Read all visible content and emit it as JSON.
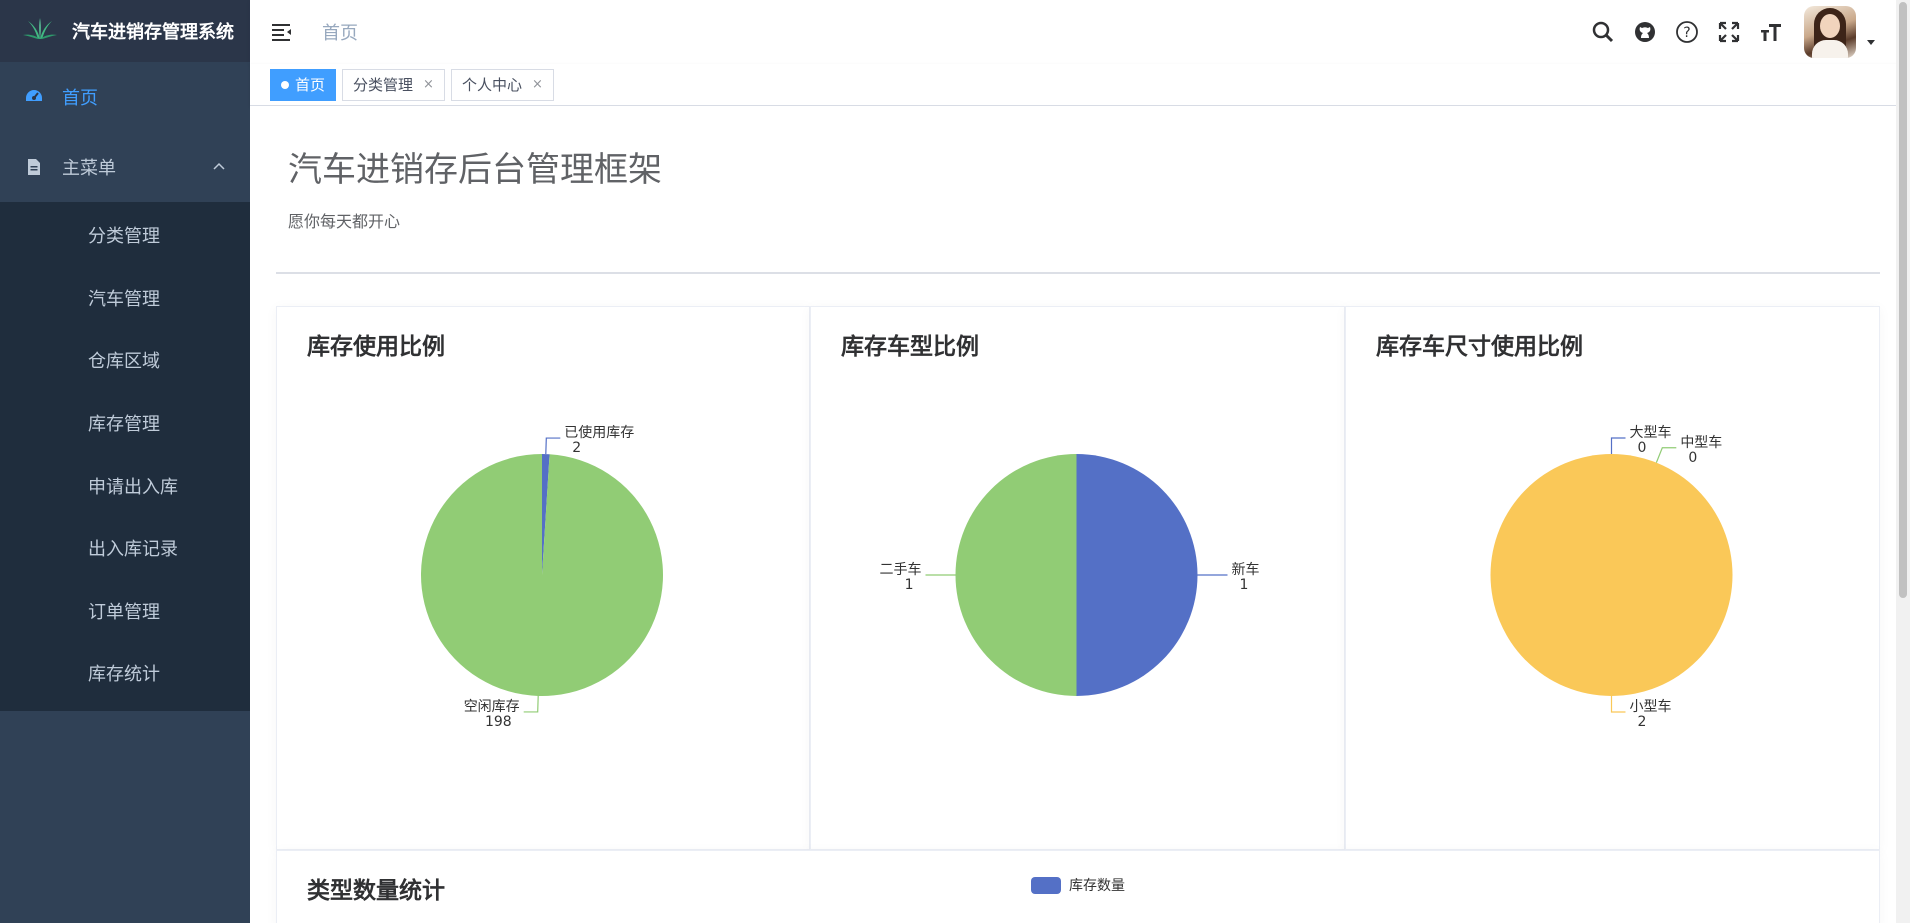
{
  "app": {
    "title": "汽车进销存管理系统"
  },
  "sidebar": {
    "home": "首页",
    "main_menu": "主菜单",
    "sub_items": [
      {
        "label": "分类管理",
        "name": "sidebar-item-category"
      },
      {
        "label": "汽车管理",
        "name": "sidebar-item-car"
      },
      {
        "label": "仓库区域",
        "name": "sidebar-item-warehouse"
      },
      {
        "label": "库存管理",
        "name": "sidebar-item-inventory"
      },
      {
        "label": "申请出入库",
        "name": "sidebar-item-apply-inout"
      },
      {
        "label": "出入库记录",
        "name": "sidebar-item-inout-records"
      },
      {
        "label": "订单管理",
        "name": "sidebar-item-orders"
      },
      {
        "label": "库存统计",
        "name": "sidebar-item-inventory-stats"
      }
    ]
  },
  "navbar": {
    "breadcrumb": "首页",
    "icons": [
      "search-icon",
      "github-icon",
      "help-icon",
      "fullscreen-icon",
      "font-size-icon"
    ]
  },
  "tags": [
    {
      "label": "首页",
      "active": true
    },
    {
      "label": "分类管理",
      "active": false,
      "close": "×"
    },
    {
      "label": "个人中心",
      "active": false,
      "close": "×"
    }
  ],
  "main": {
    "title": "汽车进销存后台管理框架",
    "subtitle": "愿你每天都开心",
    "bottom_card_title": "类型数量统计",
    "bottom_legend": "库存数量"
  },
  "colors": {
    "blue": "#5470c6",
    "green": "#91cc75",
    "yellow": "#fac858",
    "accent": "#409eff",
    "sidebar": "#304156"
  },
  "chart_data": [
    {
      "type": "pie",
      "title": "库存使用比例",
      "slices": [
        {
          "name": "已使用库存",
          "value": 2,
          "color": "#5470c6"
        },
        {
          "name": "空闲库存",
          "value": 198,
          "color": "#91cc75"
        }
      ]
    },
    {
      "type": "pie",
      "title": "库存车型比例",
      "slices": [
        {
          "name": "新车",
          "value": 1,
          "color": "#5470c6"
        },
        {
          "name": "二手车",
          "value": 1,
          "color": "#91cc75"
        }
      ]
    },
    {
      "type": "pie",
      "title": "库存车尺寸使用比例",
      "slices": [
        {
          "name": "大型车",
          "value": 0,
          "color": "#5470c6"
        },
        {
          "name": "中型车",
          "value": 0,
          "color": "#91cc75"
        },
        {
          "name": "小型车",
          "value": 2,
          "color": "#fac858"
        }
      ]
    }
  ]
}
